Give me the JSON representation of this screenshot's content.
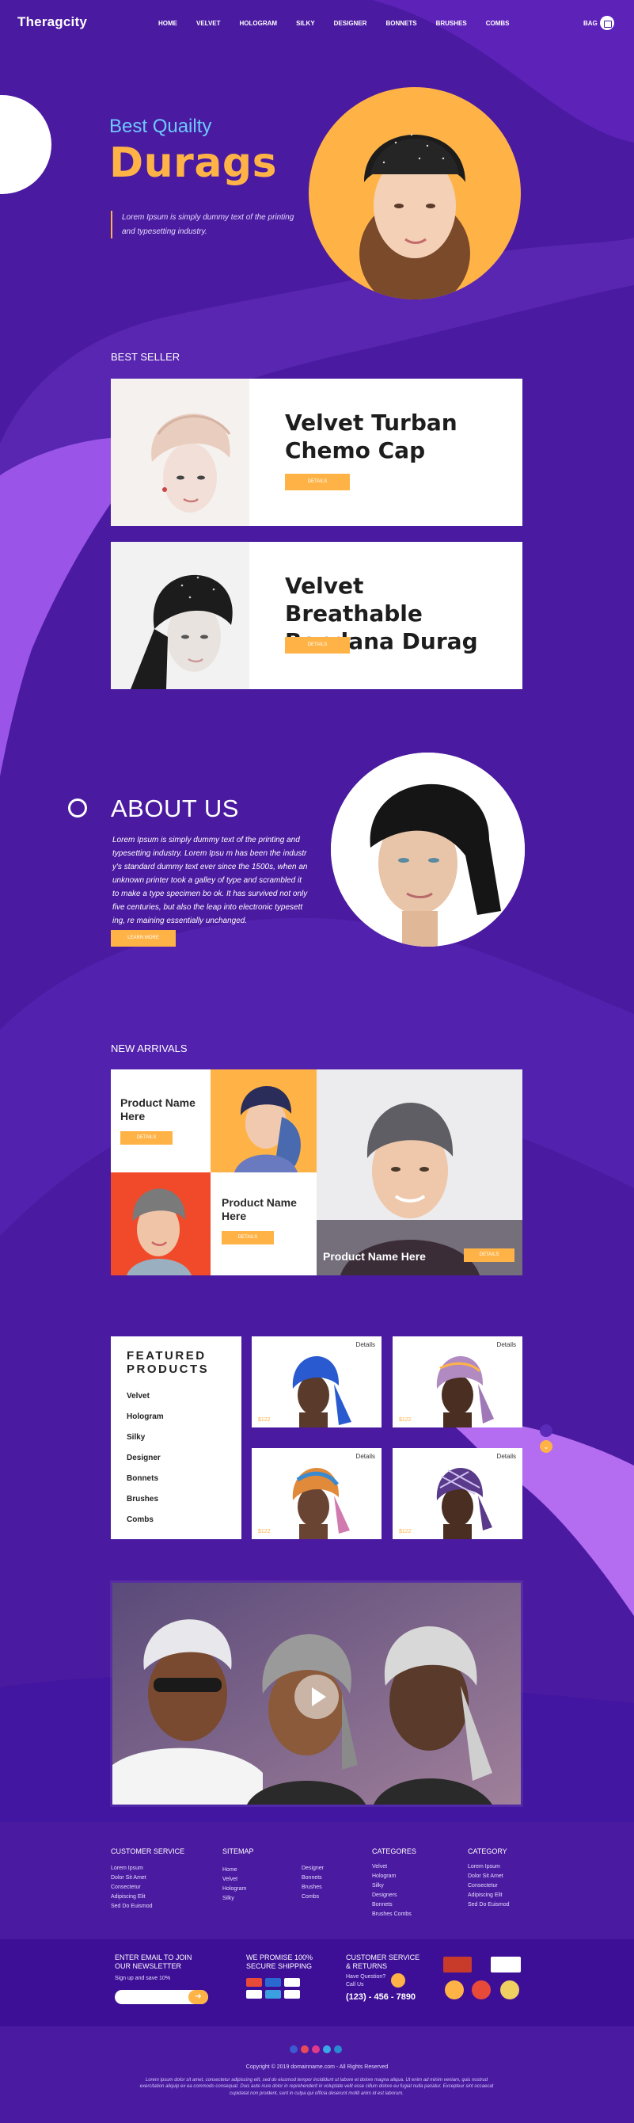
{
  "header": {
    "logo": "Theragcity",
    "nav": [
      "HOME",
      "VELVET",
      "HOLOGRAM",
      "SILKY",
      "DESIGNER",
      "BONNETS",
      "BRUSHES",
      "COMBS"
    ],
    "bag_label": "BAG"
  },
  "hero": {
    "subtitle": "Best Quailty",
    "title": "Durags",
    "text": "Lorem Ipsum is simply dummy text of the printing and typesetting industry."
  },
  "best_seller": {
    "title": "BEST SELLER",
    "items": [
      {
        "name": "Velvet Turban Chemo Cap",
        "button": "DETAILS"
      },
      {
        "name": "Velvet Breathable Bandana Durag",
        "button": "DETAILS"
      }
    ]
  },
  "about": {
    "title": "ABOUT US",
    "text": "Lorem Ipsum is simply dummy text of the printing and typesetting industry.  Lorem Ipsu m has been the industr y's standard dummy text ever since the 1500s, when an unknown printer took a galley of type and scrambled it to make a type specimen bo ok. It has survived not only five centuries, but also the leap into electronic typesett ing, re maining essentially unchanged.",
    "button": "LEARN MORE"
  },
  "new_arrivals": {
    "title": "NEW ARRIVALS",
    "items": [
      {
        "name": "Product Name Here",
        "button": "DETAILS"
      },
      {
        "name": "Product Name Here",
        "button": "DETAILS"
      },
      {
        "name": "Product Name Here",
        "button": "DETAILS"
      }
    ]
  },
  "featured": {
    "title": "FEATURED PRODUCTS",
    "menu": [
      "Velvet",
      "Hologram",
      "Silky",
      "Designer",
      "Bonnets",
      "Brushes",
      "Combs"
    ],
    "products": [
      {
        "details": "Details",
        "price": "$122"
      },
      {
        "details": "Details",
        "price": "$122"
      },
      {
        "details": "Details",
        "price": "$122"
      },
      {
        "details": "Details",
        "price": "$122"
      }
    ]
  },
  "footer": {
    "columns": [
      {
        "title": "CUSTOMER SERVICE",
        "links": [
          "Lorem Ipsum",
          "Dolor Sit Amet",
          "Consectetur",
          "Adipiscing Elit",
          "Sed Do Euismod"
        ]
      },
      {
        "title": "SITEMAP",
        "links": [
          "Home",
          "Velvet",
          "Hologram",
          "Silky"
        ],
        "links2": [
          "Designer",
          "Bonnets",
          "Brushes",
          "Combs"
        ]
      },
      {
        "title": "CATEGORES",
        "links": [
          "Velvet",
          "Hologram",
          "Silky",
          "Designers",
          "Bonnets",
          "Brushes Combs"
        ]
      },
      {
        "title": "CATEGORY",
        "links": [
          "Lorem Ipsum",
          "Dolor Sit Amet",
          "Consectetur",
          "Adipiscing Elit",
          "Sed Do Euismod"
        ]
      }
    ],
    "newsletter": {
      "title": "ENTER EMAIL TO JOIN OUR NEWSLETTER",
      "sub": "Sign up and save 10%",
      "placeholder": ""
    },
    "shipping": {
      "title": "WE PROMISE 100% SECURE SHIPPING"
    },
    "service": {
      "title": "CUSTOMER SERVICE & RETURNS",
      "line1": "Have Question?",
      "line2": "Call Us",
      "phone": "(123) - 456 - 7890"
    },
    "copyright": "Copyright © 2019 domainname.com - All Rights Reserved",
    "lorem": "Lorem ipsum dolor sit amet, consectetur adipiscing elit, sed do eiusmod tempor incididunt ut labore et dolore magna aliqua. Ut enim ad minim veniam, quis nostrud exercitation aliquip ex ea commodo consequat. Duis aute irure dolor in reprehenderit in voluptate velit esse cillum dolore eu fugiat nulla pariatur. Excepteur sint occaecat cupidatat non proident, sunt in culpa qui officia deserunt mollit anim id est laborum."
  },
  "colors": {
    "accent": "#ffb347",
    "background": "#4a1aa0",
    "light_purple": "#9a54e8",
    "hero_subtitle": "#6ec8ff"
  }
}
